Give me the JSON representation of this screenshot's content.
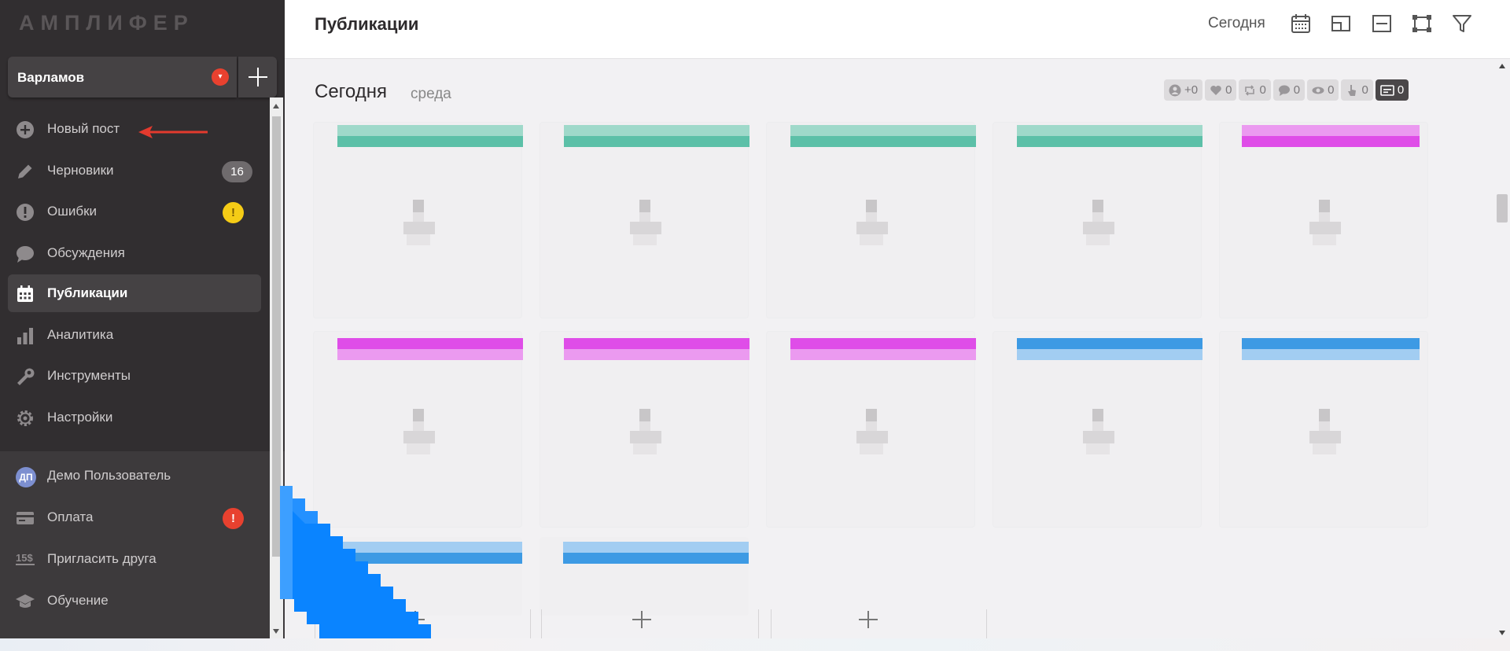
{
  "app": {
    "brand": "АМПЛИФЕР"
  },
  "project": {
    "name": "Варламов",
    "dropdown_glyph": "▾",
    "add_label": "+"
  },
  "nav": {
    "items": [
      {
        "label": "Новый пост",
        "icon": "plus-circle-icon",
        "badge": null
      },
      {
        "label": "Черновики",
        "icon": "pencil-icon",
        "badge": "16"
      },
      {
        "label": "Ошибки",
        "icon": "alert-circle-icon",
        "badge": "!"
      },
      {
        "label": "Обсуждения",
        "icon": "chat-bubble-icon",
        "badge": null
      },
      {
        "label": "Публикации",
        "icon": "calendar-icon",
        "badge": null,
        "active": true
      },
      {
        "label": "Аналитика",
        "icon": "bar-chart-icon",
        "badge": null
      },
      {
        "label": "Инструменты",
        "icon": "wrench-icon",
        "badge": null
      },
      {
        "label": "Настройки",
        "icon": "gear-icon",
        "badge": null
      }
    ],
    "bottom": [
      {
        "label": "Демо Пользователь",
        "avatar": "ДП"
      },
      {
        "label": "Оплата",
        "icon": "credit-card-icon",
        "badge": "!"
      },
      {
        "label": "Пригласить друга",
        "icon": "15-dollar-icon",
        "icon_text": "15$"
      },
      {
        "label": "Обучение",
        "icon": "graduation-cap-icon"
      }
    ]
  },
  "header": {
    "title": "Публикации",
    "today_button": "Сегодня",
    "icons": [
      "calendar-view-icon",
      "layout-compact-icon",
      "collapse-icon",
      "fullscreen-icon",
      "filter-icon"
    ]
  },
  "day": {
    "title": "Сегодня",
    "weekday": "среда",
    "stats": [
      {
        "icon": "followers-icon",
        "value": "+0"
      },
      {
        "icon": "heart-icon",
        "value": "0"
      },
      {
        "icon": "repost-icon",
        "value": "0"
      },
      {
        "icon": "comment-icon",
        "value": "0"
      },
      {
        "icon": "eye-icon",
        "value": "0"
      },
      {
        "icon": "click-icon",
        "value": "0"
      },
      {
        "icon": "posts-icon",
        "value": "0",
        "active": true
      }
    ]
  },
  "posts": {
    "stripe_colors": {
      "green": "#5cc0a8",
      "magenta": "#df4de8",
      "blue": "#3d9ae4"
    },
    "rows": [
      [
        "green",
        "green",
        "green",
        "green",
        "magenta"
      ],
      [
        "magenta",
        "magenta",
        "magenta",
        "blue",
        "blue"
      ],
      [
        "blue",
        "blue"
      ]
    ]
  },
  "colors": {
    "sidebar_bg": "#312e30",
    "accent_red": "#e8412f",
    "badge_yellow": "#f5cc16",
    "cursor_blue": "#0a84ff"
  }
}
